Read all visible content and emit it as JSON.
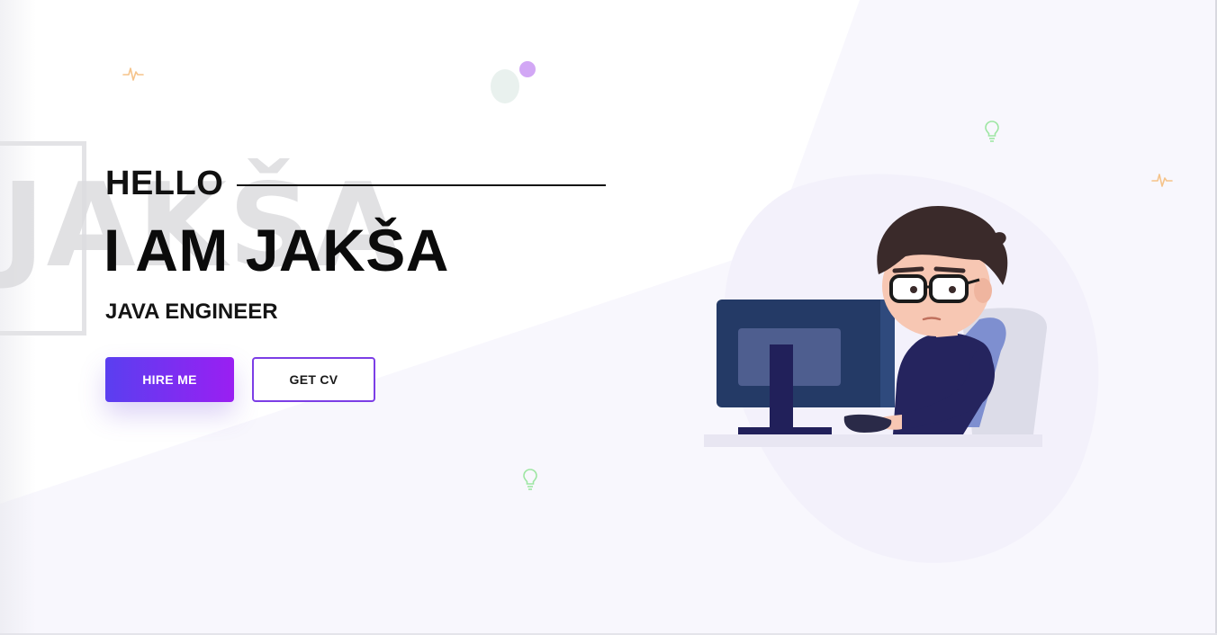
{
  "hero": {
    "ghost_name": "JAKŠA",
    "greeting": "HELLO",
    "title": "I AM JAKŠA",
    "role": "JAVA ENGINEER"
  },
  "buttons": {
    "hire_label": "HIRE ME",
    "cv_label": "GET CV"
  },
  "colors": {
    "accent_start": "#5a3ff0",
    "accent_end": "#9a1ff2",
    "outline": "#7c3ee6",
    "text": "#0b0b0b"
  },
  "icons": [
    "pulse-icon",
    "lightbulb-icon",
    "dot-icon"
  ],
  "illustration": "developer-at-computer-illustration"
}
